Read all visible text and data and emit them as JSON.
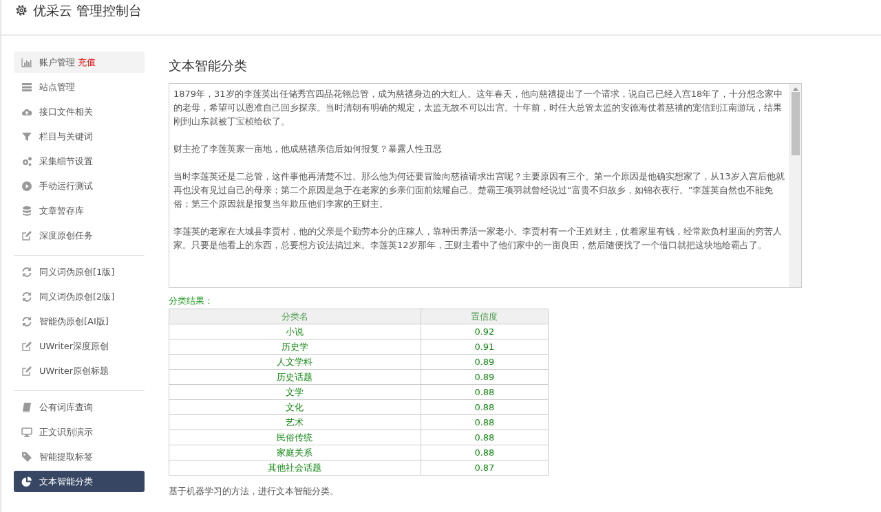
{
  "header": {
    "title": "优采云 管理控制台"
  },
  "sidebar": {
    "groups": [
      [
        {
          "kind": "chart",
          "label": "账户管理",
          "badge": "充值",
          "hovered": true,
          "selected": false
        },
        {
          "kind": "server",
          "label": "站点管理",
          "hovered": false,
          "selected": false
        },
        {
          "kind": "cloud",
          "label": "接口文件相关",
          "hovered": false,
          "selected": false
        },
        {
          "kind": "filter",
          "label": "栏目与关键词",
          "hovered": false,
          "selected": false
        },
        {
          "kind": "gears",
          "label": "采集细节设置",
          "hovered": false,
          "selected": false
        },
        {
          "kind": "play",
          "label": "手动运行测试",
          "hovered": false,
          "selected": false
        },
        {
          "kind": "database",
          "label": "文章暂存库",
          "hovered": false,
          "selected": false
        },
        {
          "kind": "edit",
          "label": "深度原创任务",
          "hovered": false,
          "selected": false
        }
      ],
      [
        {
          "kind": "refresh",
          "label": "同义词伪原创[1版]",
          "hovered": false,
          "selected": false
        },
        {
          "kind": "refresh",
          "label": "同义词伪原创[2版]",
          "hovered": false,
          "selected": false
        },
        {
          "kind": "refresh",
          "label": "智能伪原创[AI版]",
          "hovered": false,
          "selected": false
        },
        {
          "kind": "edit",
          "label": "UWriter深度原创",
          "hovered": false,
          "selected": false
        },
        {
          "kind": "edit",
          "label": "UWriter原创标题",
          "hovered": false,
          "selected": false
        }
      ],
      [
        {
          "kind": "book",
          "label": "公有词库查询",
          "hovered": false,
          "selected": false
        },
        {
          "kind": "monitor",
          "label": "正文识别演示",
          "hovered": false,
          "selected": false
        },
        {
          "kind": "tag",
          "label": "智能提取标签",
          "hovered": false,
          "selected": false
        },
        {
          "kind": "pie",
          "label": "文本智能分类",
          "hovered": false,
          "selected": true
        }
      ]
    ]
  },
  "main": {
    "title": "文本智能分类",
    "text_input": {
      "paragraphs": [
        "1879年，31岁的李莲英出任储秀宫四品花翎总管，成为慈禧身边的大红人。这年春天，他向慈禧提出了一个请求，说自己已经入宫18年了，十分想念家中的老母，希望可以恩准自己回乡探亲。当时清朝有明确的规定，太监无故不可以出宫。十年前，时任大总管太监的安德海仗着慈禧的宠信到江南游玩，结果刚到山东就被丁宝桢给砍了。",
        "财主抢了李莲英家一亩地，他成慈禧亲信后如何报复？暴露人性丑恶",
        "当时李莲英还是二总管，这件事他再清楚不过。那么他为何还要冒险向慈禧请求出宫呢？主要原因有三个。第一个原因是他确实想家了，从13岁入宫后他就再也没有见过自己的母亲；第二个原因是急于在老家的乡亲们面前炫耀自己。楚霸王项羽就曾经说过“富贵不归故乡，如锦衣夜行。”李莲英自然也不能免俗；第三个原因就是报复当年欺压他们李家的王财主。",
        "李莲英的老家在大城县李贾村，他的父亲是个勤劳本分的庄稼人，靠种田养活一家老小。李贾村有一个王姓财主，仗着家里有钱，经常欺负村里面的穷苦人家。只要是他看上的东西，总要想方设法搞过来。李莲英12岁那年，王财主看中了他们家中的一亩良田，然后随便找了一个借口就把这块地给霸占了。"
      ]
    },
    "result_label": "分类结果：",
    "table": {
      "columns": [
        "分类名",
        "置信度"
      ],
      "rows": [
        [
          "小说",
          "0.92"
        ],
        [
          "历史学",
          "0.91"
        ],
        [
          "人文学科",
          "0.89"
        ],
        [
          "历史话题",
          "0.89"
        ],
        [
          "文学",
          "0.88"
        ],
        [
          "文化",
          "0.88"
        ],
        [
          "艺术",
          "0.88"
        ],
        [
          "民俗传统",
          "0.88"
        ],
        [
          "家庭关系",
          "0.88"
        ],
        [
          "其他社会话题",
          "0.87"
        ]
      ]
    },
    "footer_note": "基于机器学习的方法，进行文本智能分类。"
  }
}
